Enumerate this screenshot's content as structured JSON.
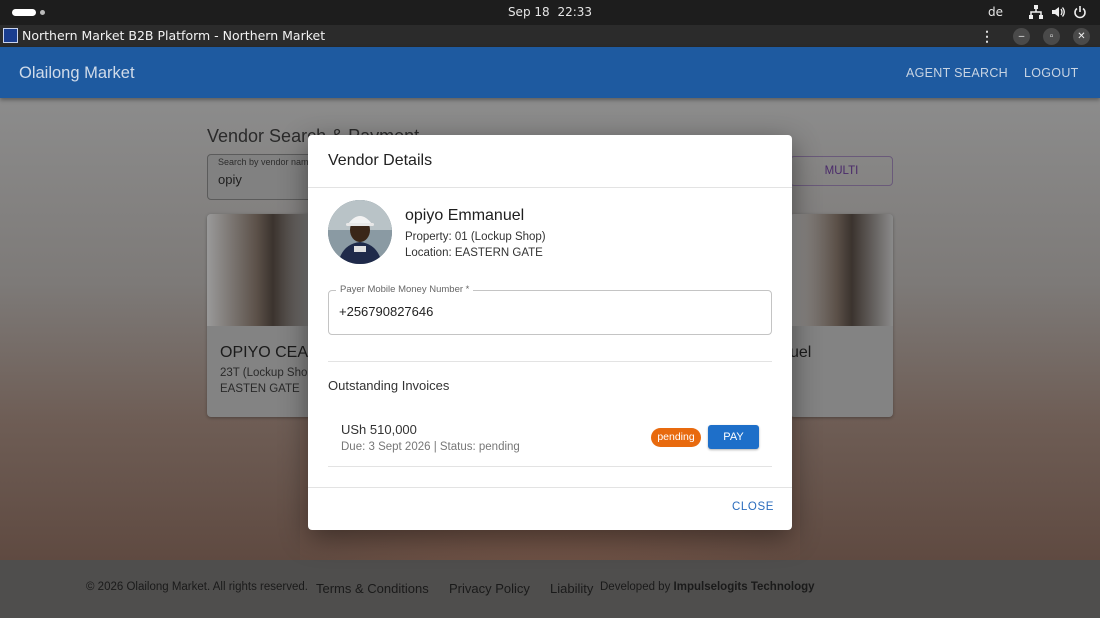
{
  "os": {
    "date": "Sep 18",
    "time": "22:33",
    "lang": "de"
  },
  "window": {
    "title": "Northern Market B2B Platform - Northern Market"
  },
  "appbar": {
    "brand": "Olailong Market",
    "nav": [
      "AGENT SEARCH",
      "LOGOUT"
    ]
  },
  "page": {
    "title": "Vendor Search & Payment",
    "search": {
      "label": "Search by vendor name",
      "value": "opiy"
    },
    "multi_label": "MULTI",
    "cards": [
      {
        "name": "OPIYO CEA",
        "property": "23T (Lockup Shop",
        "location": "EASTEN GATE"
      },
      {
        "name": "uel"
      }
    ]
  },
  "footer": {
    "copyright": "© 2026 Olailong Market. All rights reserved.",
    "links": [
      "Terms & Conditions",
      "Privacy Policy",
      "Liability"
    ],
    "developed_prefix": "Developed by",
    "developer": "Impulselogits Technology"
  },
  "modal": {
    "title": "Vendor Details",
    "vendor": {
      "name": "opiyo Emmanuel",
      "property": "Property: 01 (Lockup Shop)",
      "location": "Location: EASTERN GATE"
    },
    "phone_field": {
      "label": "Payer Mobile Money Number *",
      "value": "+256790827646"
    },
    "invoices_heading": "Outstanding Invoices",
    "invoices": [
      {
        "amount": "USh 510,000",
        "details": "Due: 3 Sept 2026 | Status: pending",
        "status": "pending",
        "action": "PAY"
      }
    ],
    "close_label": "CLOSE"
  },
  "colors": {
    "appbar": "#1e5aa0",
    "pay_button": "#1e6fc9",
    "pending_badge": "#e86a0e",
    "close_text": "#2a6cbd"
  }
}
